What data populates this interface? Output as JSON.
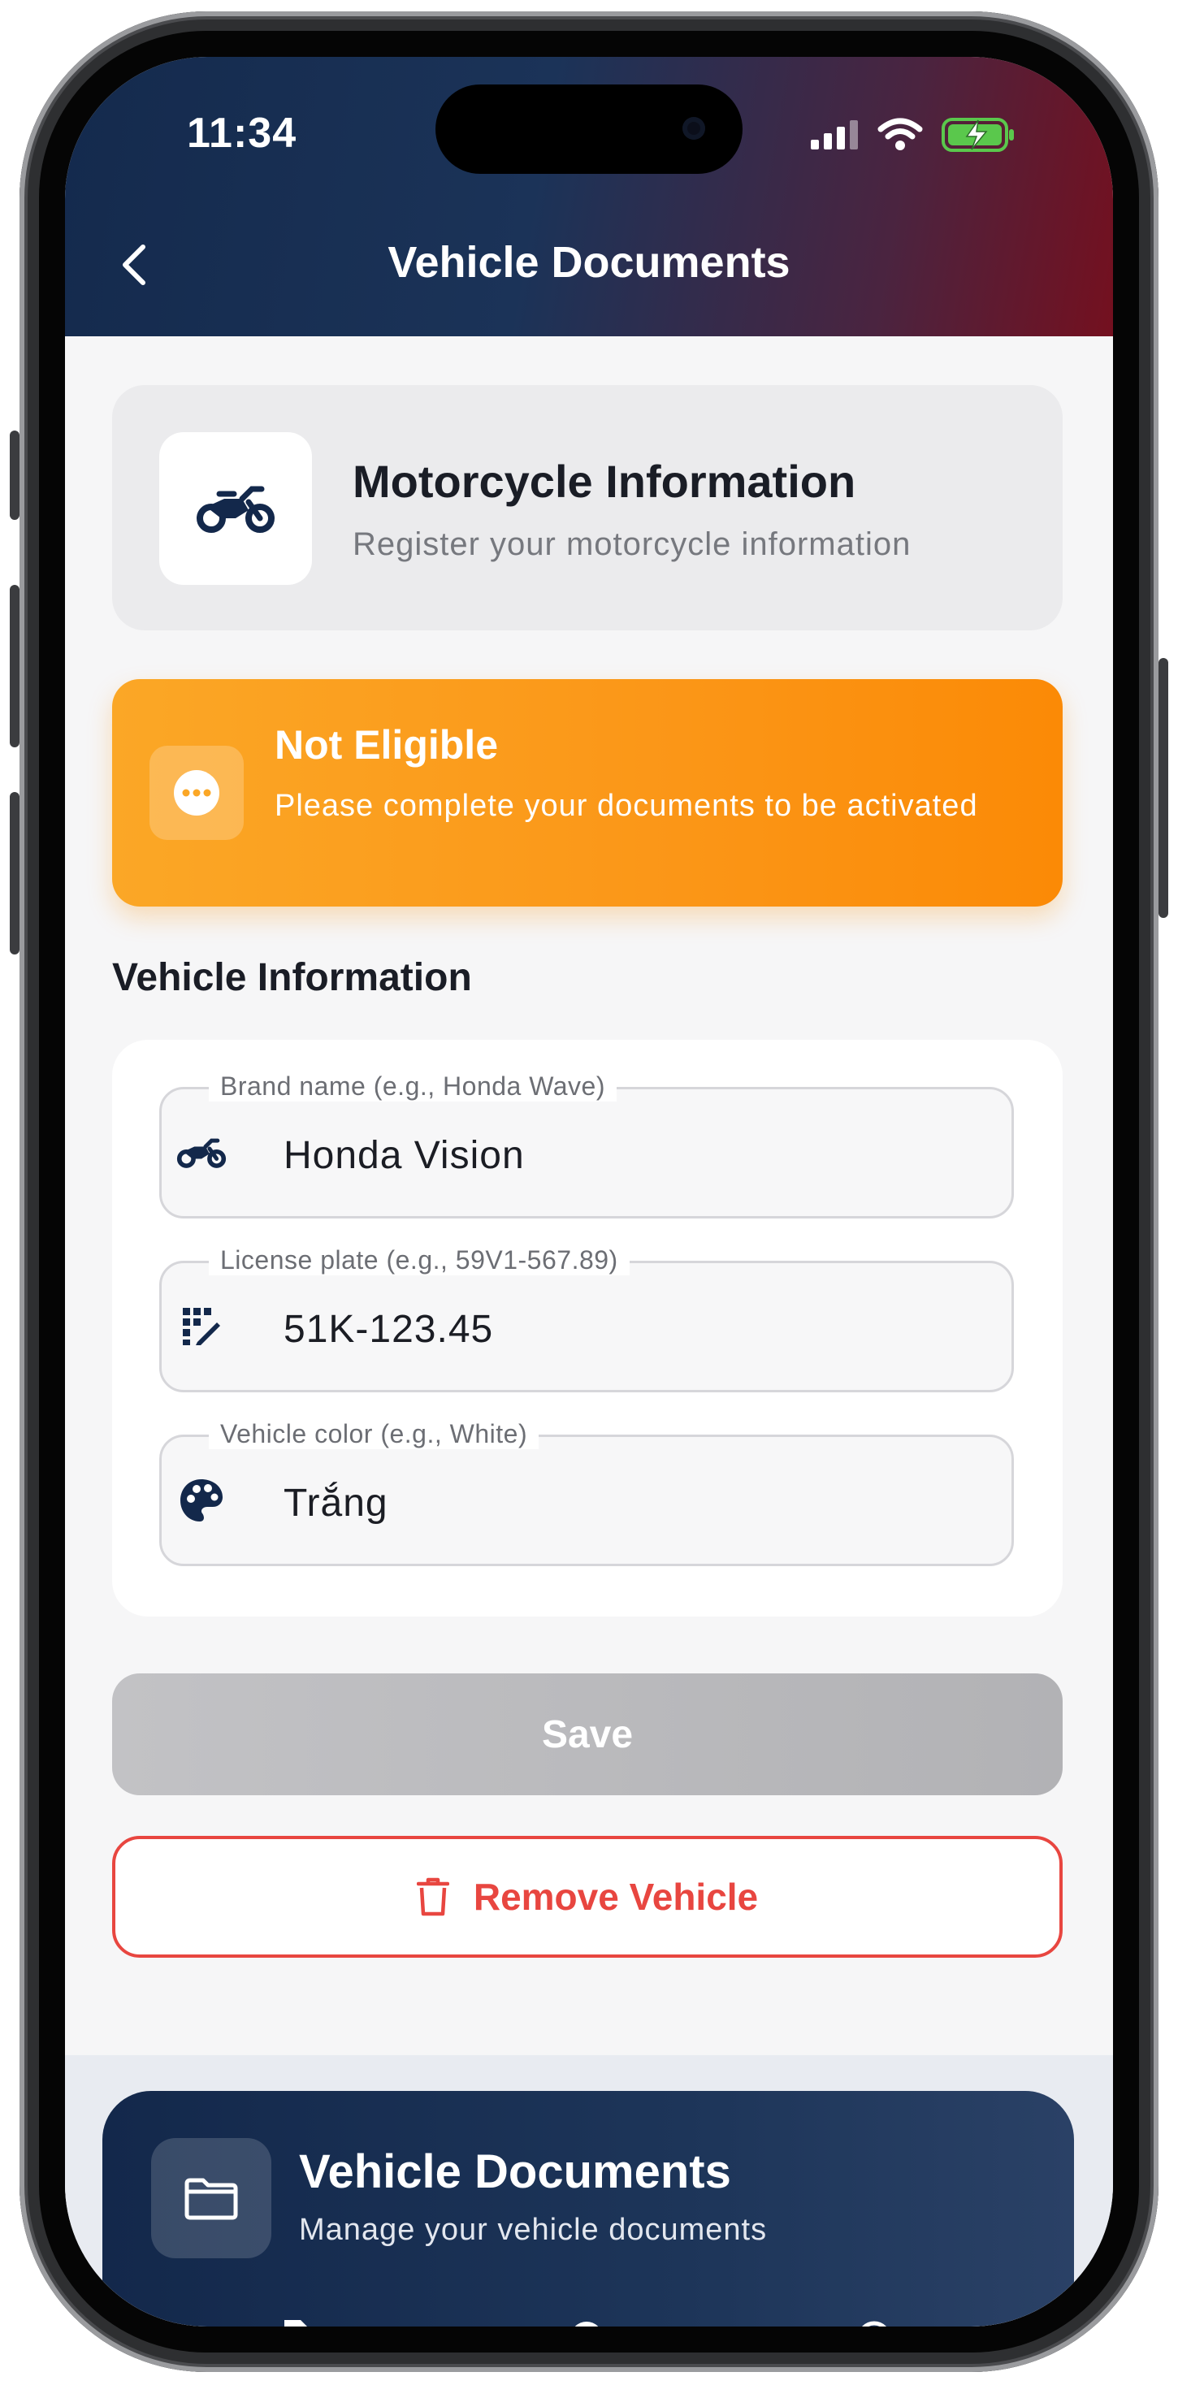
{
  "status_bar": {
    "time": "11:34"
  },
  "header": {
    "title": "Vehicle Documents"
  },
  "info_card": {
    "title": "Motorcycle Information",
    "subtitle": "Register your motorcycle information"
  },
  "alert": {
    "title": "Not Eligible",
    "message": "Please complete your documents to be activated",
    "color": "#FB9617"
  },
  "section": {
    "title": "Vehicle Information"
  },
  "form": {
    "brand": {
      "label": "Brand name (e.g., Honda Wave)",
      "value": "Honda Vision",
      "icon": "motorcycle-icon"
    },
    "plate": {
      "label": "License plate (e.g., 59V1-567.89)",
      "value": "51K-123.45",
      "icon": "license-plate-icon"
    },
    "color": {
      "label": "Vehicle color (e.g., White)",
      "value": "Trắng",
      "icon": "palette-icon"
    }
  },
  "actions": {
    "save_label": "Save",
    "remove_label": "Remove Vehicle",
    "remove_color": "#E84640"
  },
  "documents_panel": {
    "title": "Vehicle Documents",
    "subtitle": "Manage your vehicle documents"
  }
}
